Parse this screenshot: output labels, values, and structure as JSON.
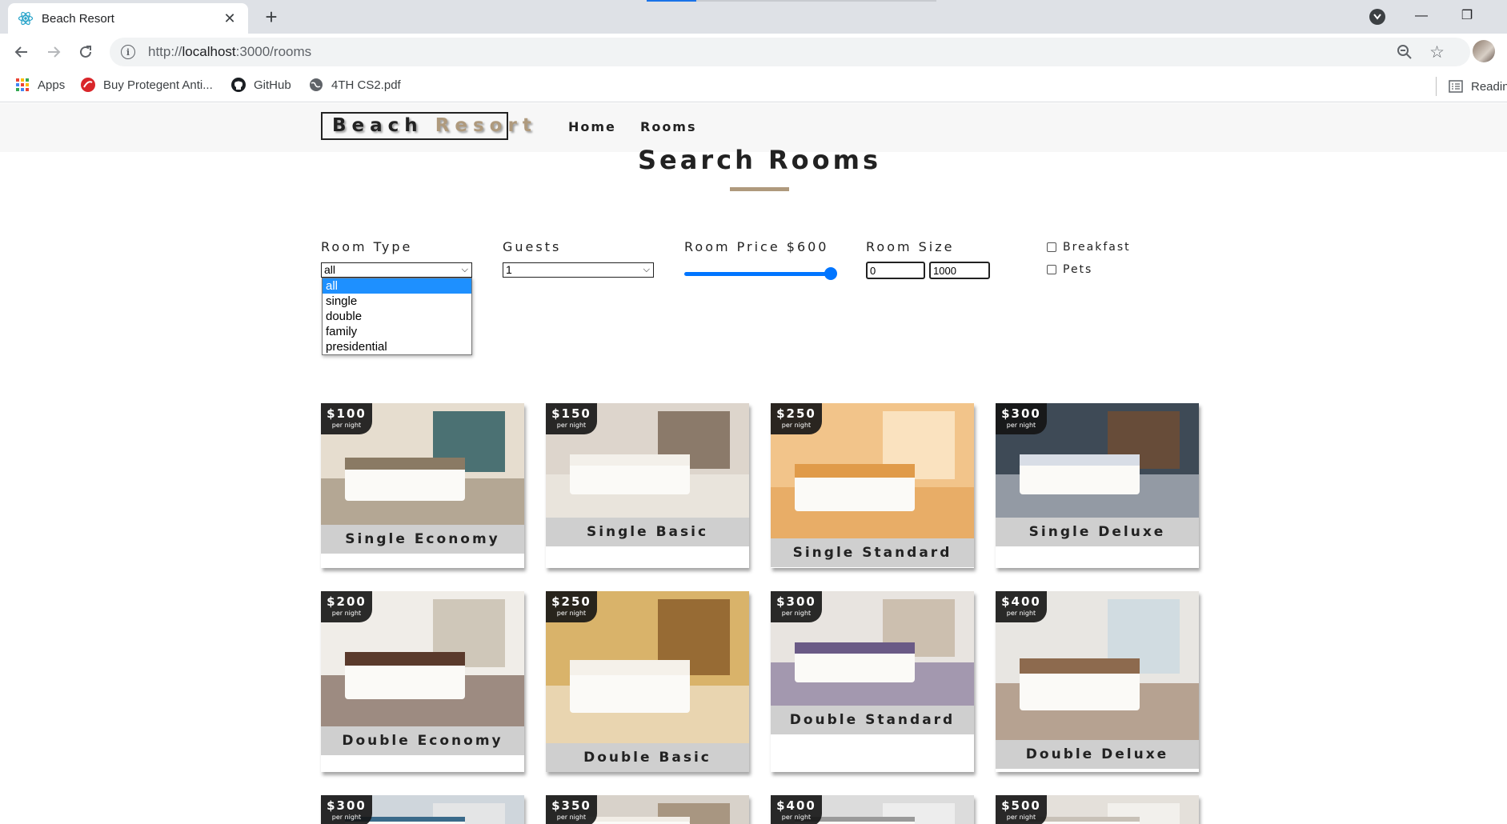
{
  "browser": {
    "tab_title": "Beach Resort",
    "url_scheme": "http://",
    "url_host": "localhost",
    "url_path": ":3000/rooms",
    "bookmarks": [
      "Apps",
      "Buy Protegent Anti...",
      "GitHub",
      "4TH CS2.pdf"
    ],
    "reading_list": "Reading"
  },
  "site": {
    "logo_part1": "Beach",
    "logo_part2": "Resort",
    "nav": [
      "Home",
      "Rooms"
    ]
  },
  "search": {
    "title": "Search Rooms",
    "room_type_label": "Room Type",
    "room_type_value": "all",
    "room_type_options": [
      "all",
      "single",
      "double",
      "family",
      "presidential"
    ],
    "guests_label": "Guests",
    "guests_value": "1",
    "price_label": "Room Price $600",
    "price_slider": {
      "value": 600,
      "max": 600
    },
    "size_label": "Room Size",
    "size_min": "0",
    "size_max": "1000",
    "breakfast_label": "Breakfast",
    "pets_label": "Pets"
  },
  "rooms": [
    {
      "name": "Single Economy",
      "price": "$100",
      "per": "per night",
      "palette": [
        "#e6ddcf",
        "#8a7a64",
        "#2f5e63"
      ]
    },
    {
      "name": "Single Basic",
      "price": "$150",
      "per": "per night",
      "palette": [
        "#ddd5cc",
        "#f3f0ea",
        "#7c6a58"
      ]
    },
    {
      "name": "Single Standard",
      "price": "$250",
      "per": "per night",
      "palette": [
        "#f2c48a",
        "#e09b4a",
        "#fbe7c8"
      ]
    },
    {
      "name": "Single Deluxe",
      "price": "$300",
      "per": "per night",
      "palette": [
        "#3e4a56",
        "#d8dde6",
        "#6f4c34"
      ]
    },
    {
      "name": "Double Economy",
      "price": "$200",
      "per": "per night",
      "palette": [
        "#f0ede8",
        "#5a3a2c",
        "#c9bfb0"
      ]
    },
    {
      "name": "Double Basic",
      "price": "$250",
      "per": "per night",
      "palette": [
        "#d9b36a",
        "#f5f1ea",
        "#8b5e2a"
      ]
    },
    {
      "name": "Double Standard",
      "price": "$300",
      "per": "per night",
      "palette": [
        "#e8e4e0",
        "#6a5a86",
        "#c7b8a6"
      ]
    },
    {
      "name": "Double Deluxe",
      "price": "$400",
      "per": "per night",
      "palette": [
        "#e8e6e2",
        "#8d6a4e",
        "#cdd9e0"
      ]
    },
    {
      "name": "",
      "price": "$300",
      "per": "per night",
      "palette": [
        "#cfd6dc",
        "#3a6a8a",
        "#e8e8e8"
      ]
    },
    {
      "name": "",
      "price": "$350",
      "per": "per night",
      "palette": [
        "#d8d2ca",
        "#f1ede6",
        "#a08c74"
      ]
    },
    {
      "name": "",
      "price": "$400",
      "per": "per night",
      "palette": [
        "#dcdcdc",
        "#9a9a9a",
        "#f0f0f0"
      ]
    },
    {
      "name": "",
      "price": "$500",
      "per": "per night",
      "palette": [
        "#e4e0da",
        "#c8c1b7",
        "#f4f2ef"
      ]
    }
  ],
  "colors": {
    "accent": "#af9a7d",
    "link_blue": "#1e90ff",
    "slider": "#0075ff"
  }
}
